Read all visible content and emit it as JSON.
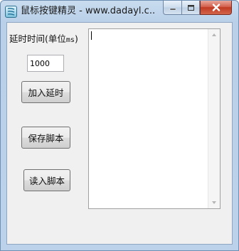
{
  "window": {
    "title": "鼠标按键精灵 - www.dadayl.c..."
  },
  "form": {
    "delay_label_prefix": "延时时间(单位",
    "delay_label_unit": "ms",
    "delay_label_suffix": ")",
    "delay_value": "1000",
    "add_delay_button": "加入延时",
    "save_script_button": "保存脚本",
    "load_script_button": "读入脚本"
  },
  "script_editor": {
    "content": ""
  },
  "icons": {
    "app": "mouse-icon",
    "minimize": "minimize-icon",
    "maximize": "maximize-icon",
    "close": "close-icon"
  }
}
